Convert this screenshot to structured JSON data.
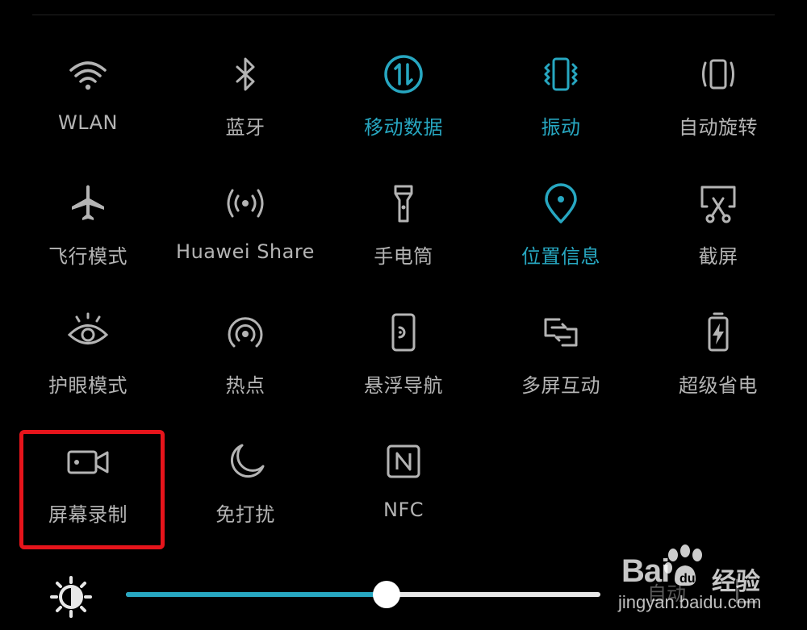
{
  "colors": {
    "active": "#27a7c1",
    "inactive": "#b4b4b4",
    "highlight": "#e6141b",
    "background": "#000000"
  },
  "tiles": [
    {
      "label": "WLAN",
      "icon": "wifi-icon",
      "active": false
    },
    {
      "label": "蓝牙",
      "icon": "bluetooth-icon",
      "active": false
    },
    {
      "label": "移动数据",
      "icon": "mobile-data-icon",
      "active": true
    },
    {
      "label": "振动",
      "icon": "vibrate-icon",
      "active": true
    },
    {
      "label": "自动旋转",
      "icon": "auto-rotate-icon",
      "active": false
    },
    {
      "label": "飞行模式",
      "icon": "airplane-icon",
      "active": false
    },
    {
      "label": "Huawei Share",
      "icon": "huawei-share-icon",
      "active": false
    },
    {
      "label": "手电筒",
      "icon": "flashlight-icon",
      "active": false
    },
    {
      "label": "位置信息",
      "icon": "location-icon",
      "active": true
    },
    {
      "label": "截屏",
      "icon": "screenshot-icon",
      "active": false
    },
    {
      "label": "护眼模式",
      "icon": "eye-comfort-icon",
      "active": false
    },
    {
      "label": "热点",
      "icon": "hotspot-icon",
      "active": false
    },
    {
      "label": "悬浮导航",
      "icon": "floating-nav-icon",
      "active": false
    },
    {
      "label": "多屏互动",
      "icon": "multi-screen-icon",
      "active": false
    },
    {
      "label": "超级省电",
      "icon": "battery-saver-icon",
      "active": false
    },
    {
      "label": "屏幕录制",
      "icon": "screen-record-icon",
      "active": false
    },
    {
      "label": "免打扰",
      "icon": "do-not-disturb-icon",
      "active": false
    },
    {
      "label": "NFC",
      "icon": "nfc-icon",
      "active": false
    }
  ],
  "brightness": {
    "icon": "brightness-icon",
    "level": 0.55,
    "auto_label": "自动"
  },
  "watermark": {
    "brand": "Bai",
    "brand_suffix": "经验",
    "url": "jingyan.baidu.com"
  }
}
